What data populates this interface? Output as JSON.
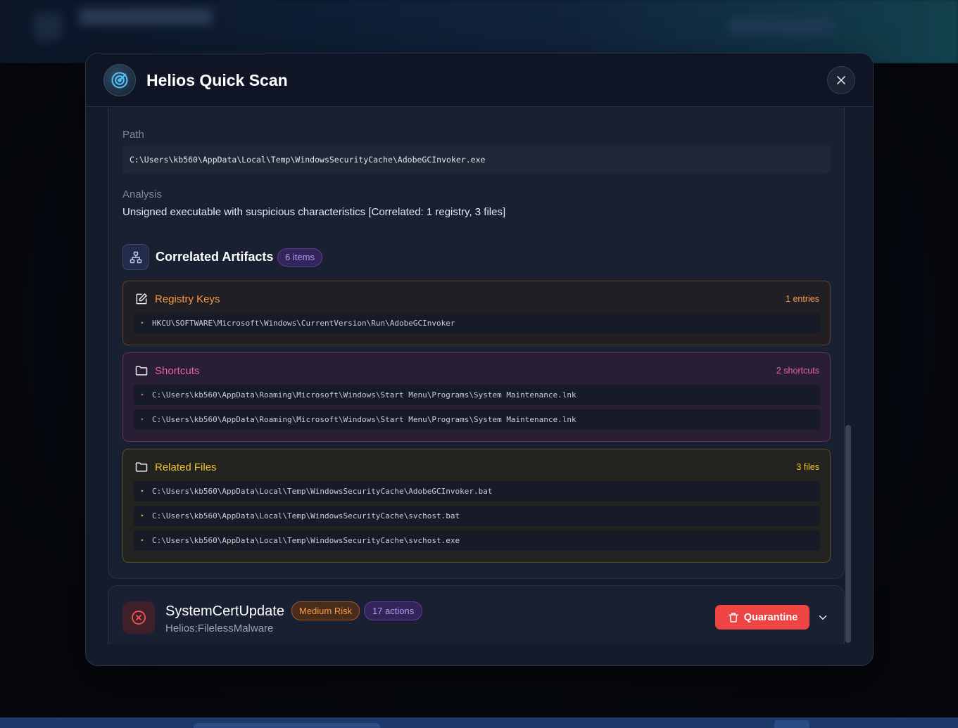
{
  "modal": {
    "title": "Helios Quick Scan"
  },
  "detail": {
    "path_label": "Path",
    "path_value": "C:\\Users\\kb560\\AppData\\Local\\Temp\\WindowsSecurityCache\\AdobeGCInvoker.exe",
    "analysis_label": "Analysis",
    "analysis_value": "Unsigned executable with suspicious characteristics [Correlated: 1 registry, 3 files]"
  },
  "correlated": {
    "title": "Correlated Artifacts",
    "count_badge": "6 items",
    "groups": [
      {
        "title": "Registry Keys",
        "count": "1 entries",
        "items": [
          "HKCU\\SOFTWARE\\Microsoft\\Windows\\CurrentVersion\\Run\\AdobeGCInvoker"
        ]
      },
      {
        "title": "Shortcuts",
        "count": "2 shortcuts",
        "items": [
          "C:\\Users\\kb560\\AppData\\Roaming\\Microsoft\\Windows\\Start Menu\\Programs\\System Maintenance.lnk",
          "C:\\Users\\kb560\\AppData\\Roaming\\Microsoft\\Windows\\Start Menu\\Programs\\System Maintenance.lnk"
        ]
      },
      {
        "title": "Related Files",
        "count": "3 files",
        "items": [
          "C:\\Users\\kb560\\AppData\\Local\\Temp\\WindowsSecurityCache\\AdobeGCInvoker.bat",
          "C:\\Users\\kb560\\AppData\\Local\\Temp\\WindowsSecurityCache\\svchost.bat",
          "C:\\Users\\kb560\\AppData\\Local\\Temp\\WindowsSecurityCache\\svchost.exe"
        ]
      }
    ]
  },
  "threat": {
    "name": "SystemCertUpdate",
    "type": "Helios:FilelessMalware",
    "risk_badge": "Medium Risk",
    "actions_badge": "17 actions",
    "quarantine_label": "Quarantine"
  },
  "icons": {
    "logo": "radar-icon",
    "close": "close-icon",
    "correlated": "network-icon",
    "registry": "edit-icon",
    "shortcuts": "folder-icon",
    "related": "folder-icon",
    "threat": "x-circle-icon",
    "quarantine": "trash-icon",
    "expand": "chevron-down-icon"
  },
  "colors": {
    "registry": "#f59b45",
    "shortcuts": "#ec5fa2",
    "related": "#f2c32d",
    "danger": "#ef4444",
    "accent_purple": "#b79bf1"
  }
}
